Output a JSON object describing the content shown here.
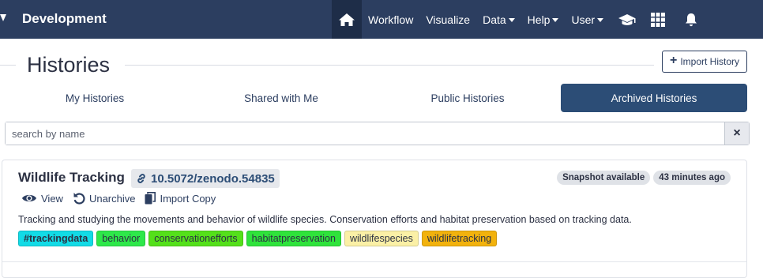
{
  "navbar": {
    "brand": "Development",
    "items": [
      {
        "label": "Workflow",
        "caret": false
      },
      {
        "label": "Visualize",
        "caret": false
      },
      {
        "label": "Data",
        "caret": true
      },
      {
        "label": "Help",
        "caret": true
      },
      {
        "label": "User",
        "caret": true
      }
    ],
    "icons": [
      "home-icon",
      "graduation-cap-icon",
      "apps-grid-icon",
      "bell-icon"
    ]
  },
  "page": {
    "title": "Histories",
    "import_button": "Import History"
  },
  "tabs": [
    {
      "label": "My Histories",
      "active": false
    },
    {
      "label": "Shared with Me",
      "active": false
    },
    {
      "label": "Public Histories",
      "active": false
    },
    {
      "label": "Archived Histories",
      "active": true
    }
  ],
  "search": {
    "placeholder": "search by name",
    "value": "",
    "clear_label": "×"
  },
  "history": {
    "title": "Wildlife Tracking",
    "doi": "10.5072/zenodo.54835",
    "badges": [
      "Snapshot available",
      "43 minutes ago"
    ],
    "actions": {
      "view": "View",
      "unarchive": "Unarchive",
      "import_copy": "Import Copy"
    },
    "description": "Tracking and studying the movements and behavior of wildlife species. Conservation efforts and habitat preservation based on tracking data.",
    "tags": [
      {
        "label": "#trackingdata",
        "color": "#12dbe6",
        "bold": true
      },
      {
        "label": "behavior",
        "color": "#2ee84a",
        "bold": false
      },
      {
        "label": "conservationefforts",
        "color": "#54e01a",
        "bold": false
      },
      {
        "label": "habitatpreservation",
        "color": "#2fe33b",
        "bold": false
      },
      {
        "label": "wildlifespecies",
        "color": "#fbf0a6",
        "bold": false
      },
      {
        "label": "wildlifetracking",
        "color": "#f2b20d",
        "bold": false
      }
    ]
  },
  "colors": {
    "navbar": "#2c3e60",
    "primary": "#2c4d76"
  }
}
